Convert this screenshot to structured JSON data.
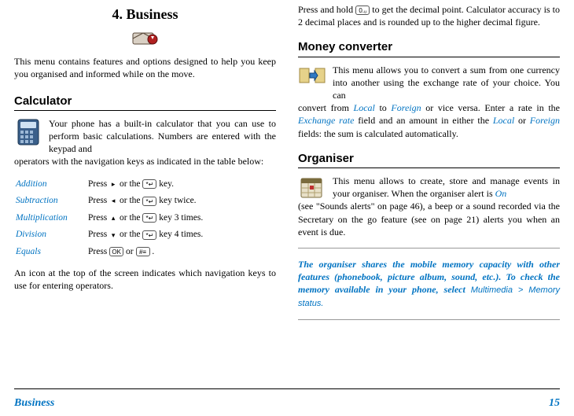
{
  "chapter": {
    "title": "4. Business"
  },
  "intro": "This menu contains features and options designed to help you keep you organised and informed while on the move.",
  "calc": {
    "heading": "Calculator",
    "body_start": "Your phone has a built-in calculator that you can use to perform basic calculations. Numbers are entered with the keypad and",
    "body_cont": "operators with the navigation keys as indicated in the table below:",
    "rows": {
      "add": {
        "name": "Addition",
        "p1": "Press ",
        "arrow": "▸",
        "p2": " or the ",
        "key": "*↵",
        "p3": " key."
      },
      "sub": {
        "name": "Subtraction",
        "p1": "Press ",
        "arrow": "◂",
        "p2": " or the ",
        "key": "*↵",
        "p3": " key twice."
      },
      "mul": {
        "name": "Multiplication",
        "p1": "Press ",
        "arrow": "▴",
        "p2": " or the ",
        "key": "*↵",
        "p3": " key 3 times."
      },
      "div": {
        "name": "Division",
        "p1": "Press ",
        "arrow": "▾",
        "p2": " or the ",
        "key": "*↵",
        "p3": " key 4 times."
      },
      "eq": {
        "name": "Equals",
        "p1": "Press ",
        "key1": "OK",
        "p2": " or ",
        "key2": "#≡",
        "p3": " ."
      }
    },
    "after": "An icon at the top of the screen indicates which navigation keys to use for entering operators."
  },
  "col2top": {
    "p1": "Press and hold ",
    "key": "0.ᵤ",
    "p2": " to get the decimal point. Calculator accuracy is to 2 decimal places and is rounded up to the higher decimal figure."
  },
  "money": {
    "heading": "Money converter",
    "body_start": "This menu allows you to convert a sum from one currency into another using the exchange rate of your choice. You can",
    "cont_a": "convert from ",
    "local": "Local",
    "to": " to ",
    "foreign": "Foreign",
    "cont_b": " or vice versa. Enter a rate in the ",
    "exrate": "Exchange rate",
    "cont_c": " field and an amount in either the ",
    "local2": "Local",
    "or": " or ",
    "foreign2": "Foreign",
    "cont_d": " fields: the sum is calculated automatically."
  },
  "org": {
    "heading": "Organiser",
    "body_start": "This menu allows to create, store and manage events in your organiser. When the organiser alert is ",
    "on": "On",
    "body_cont": " (see \"Sounds alerts\" on page 46), a beep or a sound recorded via the Secretary on the go feature (see on page 21) alerts you when an event is due.",
    "note_a": "The organiser shares the mobile memory capacity with other features (phonebook, picture album, sound, etc.). To check the memory available in your phone, select ",
    "note_sel": "Multimedia > Memory status."
  },
  "footer": {
    "section": "Business",
    "page": "15"
  }
}
